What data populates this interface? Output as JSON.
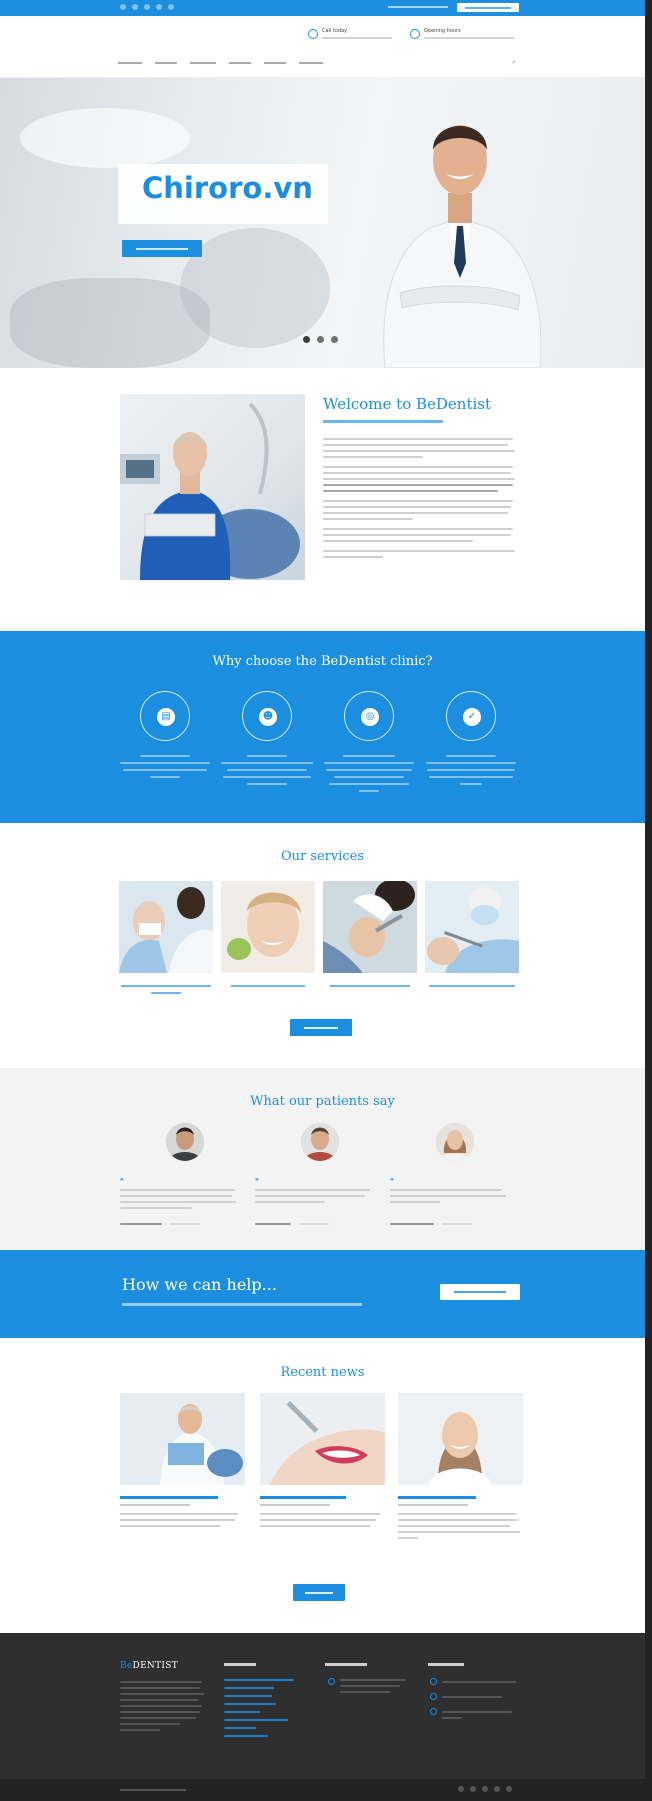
{
  "colors": {
    "accent": "#1b8ee0",
    "dark": "#2f2f2f",
    "light_bg": "#f3f3f3"
  },
  "header": {
    "phone_title": "Call today",
    "hours_title": "Opening hours"
  },
  "hero": {
    "watermark": "Chiroro.vn"
  },
  "welcome": {
    "title": "Welcome to BeDentist"
  },
  "why": {
    "title": "Why choose the BeDentist clinic?",
    "icons": [
      "calendar-icon",
      "team-icon",
      "target-icon",
      "thumbs-up-icon"
    ]
  },
  "services": {
    "title": "Our services"
  },
  "testimonials": {
    "title": "What our patients say"
  },
  "help": {
    "title": "How we can help..."
  },
  "news": {
    "title": "Recent news"
  },
  "footer": {
    "logo_be": "Be",
    "logo_rest": "DENTIST"
  }
}
